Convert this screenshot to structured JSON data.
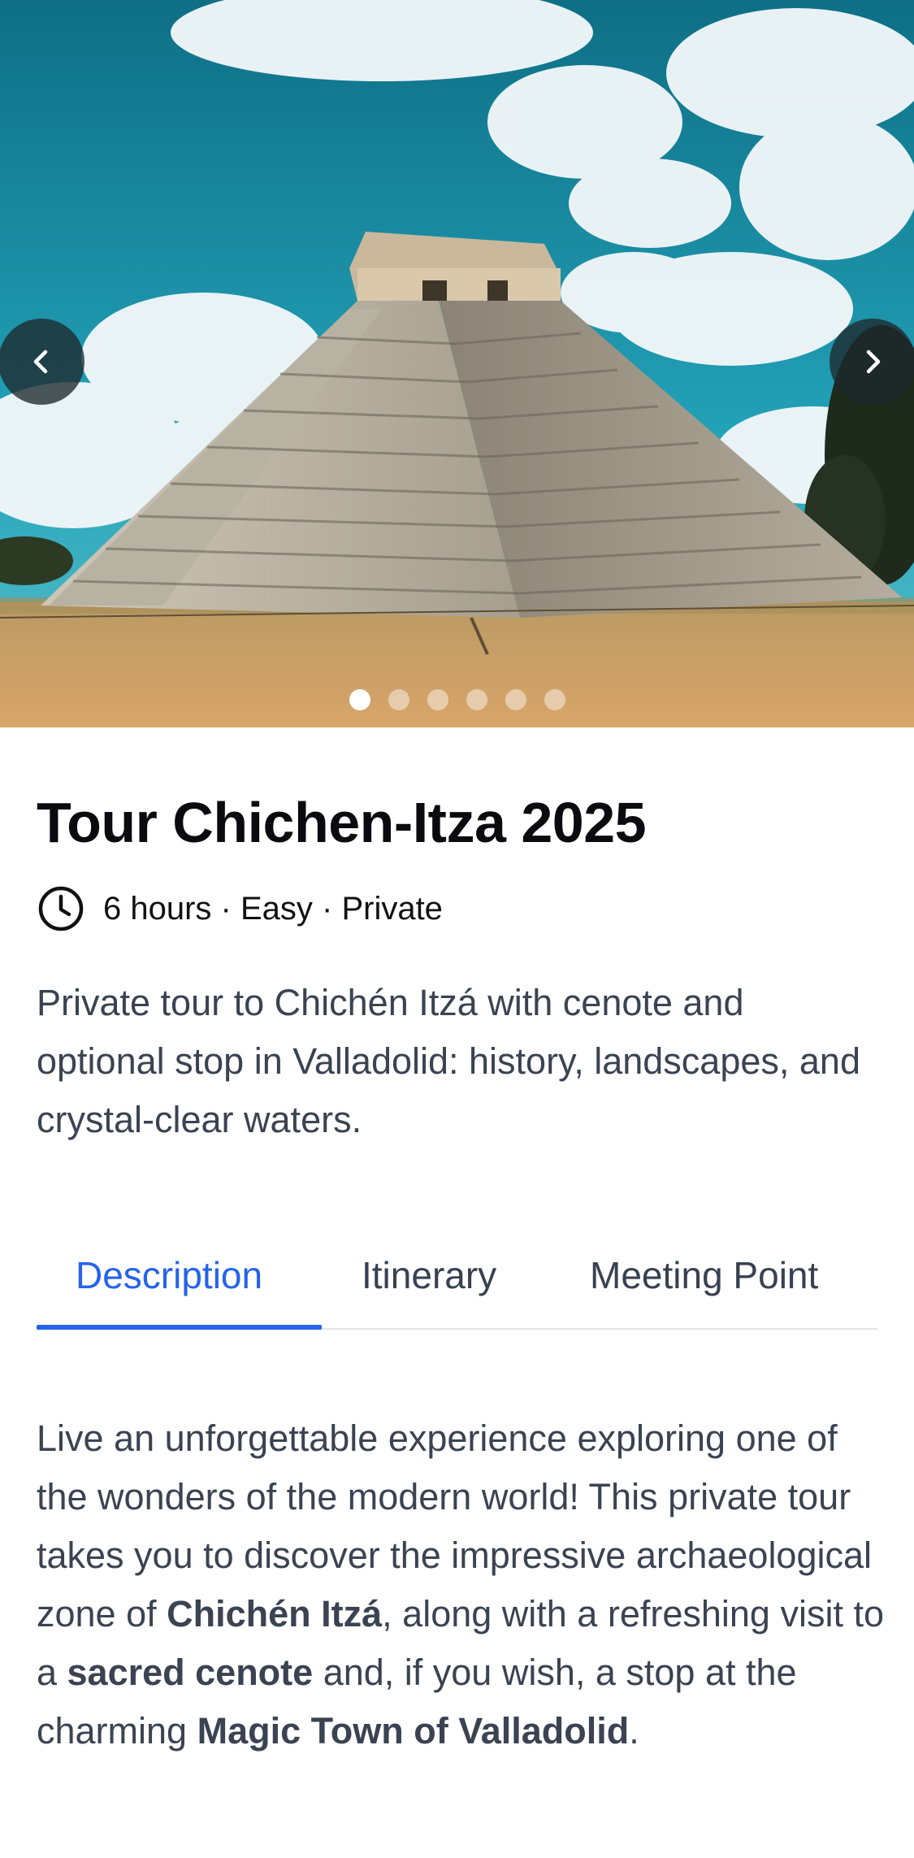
{
  "hero": {
    "image_icon": "pyramid-photo",
    "prev_icon": "chevron-left-icon",
    "next_icon": "chevron-right-icon",
    "slide_count": 6,
    "active_slide": 1
  },
  "tour": {
    "title": "Tour Chichen-Itza 2025",
    "meta_icon": "clock-icon",
    "meta": "6 hours · Easy · Private",
    "summary": "Private tour to Chichén Itzá with cenote and optional stop in Valladolid: history, landscapes, and crystal-clear waters."
  },
  "tabs": [
    {
      "label": "Description",
      "active": true
    },
    {
      "label": "Itinerary",
      "active": false
    },
    {
      "label": "Meeting Point",
      "active": false
    }
  ],
  "description": {
    "part1": "Live an unforgettable experience exploring one of the wonders of the modern world! This private tour takes you to discover the impressive archaeological zone of ",
    "bold1": "Chichén Itzá",
    "part2": ", along with a refreshing visit to a ",
    "bold2": "sacred cenote",
    "part3": " and, if you wish, a stop at the charming ",
    "bold3": "Magic Town of Valladolid",
    "part4": "."
  },
  "colors": {
    "accent": "#2563eb",
    "body_text": "#3b4352",
    "sky": "#1f9bb0"
  }
}
